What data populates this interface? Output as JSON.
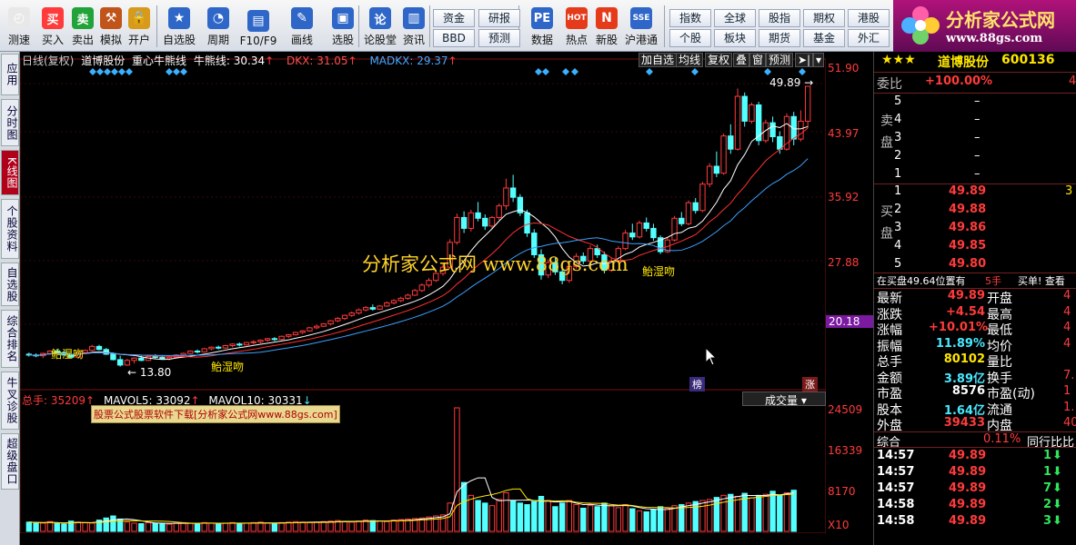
{
  "toolbar": [
    {
      "label": "测速",
      "icon": "clock-icon",
      "color": "#e8e8e8"
    },
    {
      "label": "买入",
      "glyph": "买",
      "color": "#ff3b3b"
    },
    {
      "label": "卖出",
      "glyph": "卖",
      "color": "#21a33a"
    },
    {
      "label": "模拟",
      "icon": "gavel-icon",
      "color": "#c0541a"
    },
    {
      "label": "开户",
      "icon": "lock-icon",
      "color": "#d89a1a"
    },
    {
      "label": "自选股",
      "icon": "star-icon",
      "color": "#2f67c9"
    },
    {
      "label": "周期",
      "icon": "cycle-icon",
      "color": "#2f67c9"
    },
    {
      "label": "F10/F9",
      "icon": "f10-icon",
      "color": "#2f67c9"
    },
    {
      "label": "画线",
      "icon": "pen-icon",
      "color": "#2f67c9"
    },
    {
      "label": "选股",
      "icon": "screen-icon",
      "color": "#2f67c9"
    },
    {
      "label": "论股堂",
      "glyph": "论",
      "color": "#2f67c9"
    },
    {
      "label": "资讯",
      "icon": "news-icon",
      "color": "#2f67c9"
    },
    {
      "label": "数据",
      "glyph": "PE",
      "color": "#2f67c9"
    },
    {
      "label": "热点",
      "glyph": "HOT",
      "color": "#e53b1a"
    },
    {
      "label": "新股",
      "icon": "newstock-icon",
      "color": "#e53b1a"
    },
    {
      "label": "沪港通",
      "glyph": "SSE",
      "color": "#2f67c9"
    }
  ],
  "grid_buttons_left": [
    "资金",
    "研报",
    "BBD",
    "预测"
  ],
  "grid_buttons_right": [
    "指数",
    "全球",
    "股指",
    "期权",
    "港股",
    "个股",
    "板块",
    "期货",
    "基金",
    "外汇"
  ],
  "logo": {
    "title": "分析家公式网",
    "url": "www.88gs.com"
  },
  "side_tabs": [
    "应用",
    "分时图",
    "K线图",
    "个股资料",
    "自选股",
    "综合排名",
    "牛叉诊股",
    "超级盘口"
  ],
  "chart_header": {
    "period": "日线(复权)",
    "stock": "道博股份",
    "line1": "重心牛熊线",
    "line2": "牛熊线: 30.34",
    "dkx": "DKX: 31.05",
    "madkx": "MADKX: 29.37"
  },
  "chart_buttons": [
    "加自选",
    "均线",
    "复权",
    "叠",
    "窗",
    "预测"
  ],
  "price_axis": [
    "51.90",
    "43.97",
    "35.92",
    "27.88",
    "20.18"
  ],
  "volume_axis": [
    "24509",
    "16339",
    "8170",
    "X10"
  ],
  "annotations": {
    "high": "49.89",
    "low": "13.80",
    "kiss": "鲐湿吻",
    "watermark": "分析家公式网  www.88gs.com",
    "bang": "榜",
    "zhang": "涨"
  },
  "volume_header": {
    "total": "总手: 35209",
    "mavol5": "MAVOL5: 33092",
    "mavol10": "MAVOL10: 30331",
    "selector": "成交量"
  },
  "ad_banner": "股票公式股票软件下载[分析家公式网www.88gs.com]",
  "quote": {
    "stars": "★★★",
    "name": "道博股份",
    "code": "600136",
    "weibi_label": "委比",
    "weibi_value": "+100.00%",
    "weibi_extra": "4",
    "sell_label": "卖盘",
    "buy_label": "买盘",
    "sells": [
      {
        "n": "5",
        "p": "–"
      },
      {
        "n": "4",
        "p": "–"
      },
      {
        "n": "3",
        "p": "–"
      },
      {
        "n": "2",
        "p": "–"
      },
      {
        "n": "1",
        "p": "–"
      }
    ],
    "buys": [
      {
        "n": "1",
        "p": "49.89",
        "v": "3"
      },
      {
        "n": "2",
        "p": "49.88",
        "v": ""
      },
      {
        "n": "3",
        "p": "49.86",
        "v": ""
      },
      {
        "n": "4",
        "p": "49.85",
        "v": ""
      },
      {
        "n": "5",
        "p": "49.80",
        "v": ""
      }
    ],
    "status_line": "在买盘49.64位置有",
    "status_hand": "5手",
    "status_link": "买单! 查看",
    "stats": [
      {
        "l1": "最新",
        "v1": "49.89",
        "c1": "red",
        "l2": "开盘",
        "v2": "4"
      },
      {
        "l1": "涨跌",
        "v1": "+4.54",
        "c1": "red",
        "l2": "最高",
        "v2": "4"
      },
      {
        "l1": "涨幅",
        "v1": "+10.01%",
        "c1": "red",
        "l2": "最低",
        "v2": "4"
      },
      {
        "l1": "振幅",
        "v1": "11.89%",
        "c1": "cyan",
        "l2": "均价",
        "v2": "4"
      },
      {
        "l1": "总手",
        "v1": "80102",
        "c1": "yellow",
        "l2": "量比",
        "v2": ""
      },
      {
        "l1": "金额",
        "v1": "3.89亿",
        "c1": "cyan",
        "l2": "换手",
        "v2": "7."
      },
      {
        "l1": "市盈",
        "v1": "8576",
        "c1": "white",
        "l2": "市盈(动)",
        "v2": "1"
      },
      {
        "l1": "股本",
        "v1": "1.64亿",
        "c1": "cyan",
        "l2": "流通",
        "v2": "1."
      },
      {
        "l1": "外盘",
        "v1": "39433",
        "c1": "red",
        "l2": "内盘",
        "v2": "40"
      }
    ],
    "composite_label": "综合",
    "composite_value": "0.11%",
    "industry_label": "同行比比",
    "ticks": [
      {
        "t": "14:57",
        "p": "49.89",
        "v": "1"
      },
      {
        "t": "14:57",
        "p": "49.89",
        "v": "1"
      },
      {
        "t": "14:57",
        "p": "49.89",
        "v": "7"
      },
      {
        "t": "14:58",
        "p": "49.89",
        "v": "2"
      },
      {
        "t": "14:58",
        "p": "49.89",
        "v": "3"
      }
    ]
  },
  "chart_data": {
    "type": "candlestick",
    "ylim": [
      12,
      52
    ],
    "candles": [
      [
        15.4,
        15.6,
        15.1,
        15.3
      ],
      [
        15.3,
        15.5,
        15.0,
        15.2
      ],
      [
        15.2,
        15.6,
        14.9,
        15.5
      ],
      [
        15.5,
        15.9,
        15.3,
        15.8
      ],
      [
        15.8,
        16.1,
        15.5,
        15.6
      ],
      [
        15.6,
        15.9,
        15.2,
        15.3
      ],
      [
        15.3,
        15.5,
        14.9,
        15.0
      ],
      [
        15.0,
        15.7,
        14.9,
        15.6
      ],
      [
        15.6,
        16.0,
        15.4,
        15.9
      ],
      [
        15.9,
        16.6,
        15.8,
        16.4
      ],
      [
        16.4,
        16.6,
        15.9,
        16.0
      ],
      [
        16.0,
        16.2,
        15.3,
        15.4
      ],
      [
        15.4,
        15.6,
        14.6,
        14.7
      ],
      [
        14.7,
        15.2,
        13.8,
        14.0
      ],
      [
        14.0,
        14.8,
        13.9,
        14.6
      ],
      [
        14.6,
        15.0,
        14.2,
        14.9
      ],
      [
        14.9,
        15.2,
        14.5,
        14.6
      ],
      [
        14.6,
        15.3,
        14.5,
        15.1
      ],
      [
        15.1,
        15.4,
        14.8,
        15.0
      ],
      [
        15.0,
        15.3,
        14.7,
        14.8
      ],
      [
        14.8,
        15.1,
        14.6,
        15.0
      ],
      [
        15.0,
        15.4,
        14.9,
        15.3
      ],
      [
        15.3,
        15.6,
        15.1,
        15.5
      ],
      [
        15.5,
        15.9,
        15.4,
        15.8
      ],
      [
        15.8,
        16.0,
        15.5,
        15.7
      ],
      [
        15.7,
        16.2,
        15.6,
        16.1
      ],
      [
        16.1,
        16.4,
        15.9,
        16.3
      ],
      [
        16.3,
        16.5,
        16.0,
        16.2
      ],
      [
        16.2,
        16.6,
        16.1,
        16.5
      ],
      [
        16.5,
        16.8,
        16.3,
        16.7
      ],
      [
        16.7,
        16.9,
        16.4,
        16.6
      ],
      [
        16.6,
        17.0,
        16.5,
        16.9
      ],
      [
        16.9,
        17.2,
        16.7,
        17.0
      ],
      [
        17.0,
        17.3,
        16.8,
        17.2
      ],
      [
        17.2,
        17.5,
        17.0,
        17.4
      ],
      [
        17.4,
        17.6,
        17.1,
        17.3
      ],
      [
        17.3,
        17.8,
        17.2,
        17.7
      ],
      [
        17.7,
        18.0,
        17.5,
        17.9
      ],
      [
        17.9,
        18.3,
        17.8,
        18.2
      ],
      [
        18.2,
        18.5,
        18.0,
        18.4
      ],
      [
        18.4,
        18.9,
        18.3,
        18.8
      ],
      [
        18.8,
        19.2,
        18.6,
        19.0
      ],
      [
        19.0,
        19.4,
        18.9,
        19.3
      ],
      [
        19.3,
        19.8,
        19.1,
        19.7
      ],
      [
        19.7,
        20.2,
        19.5,
        20.0
      ],
      [
        20.0,
        20.5,
        19.8,
        20.4
      ],
      [
        20.4,
        20.9,
        20.2,
        20.7
      ],
      [
        20.7,
        21.3,
        20.5,
        21.1
      ],
      [
        21.1,
        21.6,
        20.9,
        21.4
      ],
      [
        21.4,
        21.8,
        21.0,
        21.2
      ],
      [
        21.2,
        21.7,
        21.1,
        21.6
      ],
      [
        21.6,
        22.2,
        21.5,
        22.0
      ],
      [
        22.0,
        22.5,
        21.8,
        22.3
      ],
      [
        22.3,
        22.8,
        22.1,
        22.6
      ],
      [
        22.6,
        23.2,
        22.4,
        23.0
      ],
      [
        23.0,
        23.8,
        22.9,
        23.6
      ],
      [
        23.6,
        24.5,
        23.4,
        24.3
      ],
      [
        24.3,
        25.2,
        24.0,
        24.9
      ],
      [
        24.9,
        26.0,
        24.7,
        25.8
      ],
      [
        25.8,
        27.0,
        25.5,
        26.6
      ],
      [
        26.6,
        30.2,
        26.4,
        29.8
      ],
      [
        29.8,
        33.5,
        29.5,
        33.0
      ],
      [
        33.0,
        33.8,
        31.0,
        31.6
      ],
      [
        31.6,
        34.0,
        31.2,
        33.6
      ],
      [
        33.6,
        35.0,
        32.5,
        32.9
      ],
      [
        32.9,
        33.4,
        31.4,
        31.9
      ],
      [
        31.9,
        33.2,
        31.5,
        33.0
      ],
      [
        33.0,
        34.8,
        32.7,
        34.5
      ],
      [
        34.5,
        38.0,
        34.0,
        36.8
      ],
      [
        36.8,
        38.5,
        35.0,
        35.6
      ],
      [
        35.6,
        36.0,
        33.2,
        33.6
      ],
      [
        33.6,
        34.0,
        30.5,
        31.0
      ],
      [
        31.0,
        31.5,
        27.8,
        28.2
      ],
      [
        28.2,
        28.9,
        25.0,
        25.6
      ],
      [
        25.6,
        27.6,
        25.2,
        27.2
      ],
      [
        27.2,
        27.8,
        25.6,
        26.0
      ],
      [
        26.0,
        26.6,
        24.4,
        24.9
      ],
      [
        24.9,
        27.0,
        24.6,
        26.7
      ],
      [
        26.7,
        28.4,
        26.4,
        28.0
      ],
      [
        28.0,
        28.5,
        27.0,
        27.4
      ],
      [
        27.4,
        29.4,
        27.1,
        29.0
      ],
      [
        29.0,
        29.5,
        27.8,
        28.2
      ],
      [
        28.2,
        28.6,
        25.8,
        26.2
      ],
      [
        26.2,
        27.8,
        26.0,
        27.4
      ],
      [
        27.4,
        29.3,
        27.2,
        29.0
      ],
      [
        29.0,
        31.4,
        28.8,
        31.0
      ],
      [
        31.0,
        32.2,
        30.1,
        30.5
      ],
      [
        30.5,
        32.6,
        30.3,
        32.3
      ],
      [
        32.3,
        33.0,
        31.2,
        31.6
      ],
      [
        31.6,
        32.2,
        30.0,
        30.4
      ],
      [
        30.4,
        30.7,
        28.3,
        28.6
      ],
      [
        28.6,
        30.4,
        28.4,
        30.1
      ],
      [
        30.1,
        33.2,
        29.9,
        32.9
      ],
      [
        32.9,
        33.7,
        31.9,
        32.2
      ],
      [
        32.2,
        35.2,
        32.0,
        34.9
      ],
      [
        34.9,
        35.5,
        33.5,
        33.9
      ],
      [
        33.9,
        37.6,
        33.7,
        37.3
      ],
      [
        37.3,
        40.0,
        36.9,
        39.6
      ],
      [
        39.6,
        41.5,
        38.2,
        38.7
      ],
      [
        38.7,
        43.8,
        38.5,
        43.5
      ],
      [
        43.5,
        45.0,
        41.2,
        41.8
      ],
      [
        41.8,
        49.6,
        41.6,
        48.6
      ],
      [
        48.6,
        49.1,
        44.7,
        45.4
      ],
      [
        45.4,
        47.8,
        45.1,
        47.5
      ],
      [
        47.5,
        47.9,
        42.3,
        42.9
      ],
      [
        42.9,
        45.6,
        42.6,
        45.2
      ],
      [
        45.2,
        46.0,
        42.7,
        43.4
      ],
      [
        43.4,
        44.1,
        41.2,
        41.8
      ],
      [
        41.8,
        46.4,
        41.6,
        46.0
      ],
      [
        46.0,
        46.6,
        42.3,
        43.1
      ],
      [
        43.1,
        46.8,
        42.8,
        45.4
      ],
      [
        45.4,
        49.89,
        44.5,
        49.89
      ]
    ],
    "volumes": [
      18,
      17,
      16,
      19,
      15,
      14,
      20,
      18,
      17,
      16,
      22,
      26,
      30,
      24,
      18,
      16,
      15,
      17,
      16,
      15,
      14,
      16,
      17,
      16,
      15,
      17,
      16,
      15,
      16,
      17,
      15,
      16,
      17,
      18,
      16,
      15,
      17,
      18,
      19,
      18,
      17,
      18,
      19,
      20,
      21,
      19,
      18,
      20,
      22,
      21,
      20,
      19,
      22,
      23,
      24,
      25,
      26,
      28,
      30,
      32,
      55,
      240,
      95,
      70,
      60,
      55,
      50,
      62,
      75,
      60,
      55,
      52,
      58,
      68,
      60,
      48,
      55,
      60,
      52,
      45,
      50,
      48,
      55,
      50,
      46,
      52,
      44,
      40,
      38,
      42,
      48,
      45,
      50,
      52,
      55,
      58,
      60,
      62,
      66,
      70,
      72,
      68,
      74,
      65,
      70,
      72,
      78,
      70,
      75,
      80
    ]
  }
}
